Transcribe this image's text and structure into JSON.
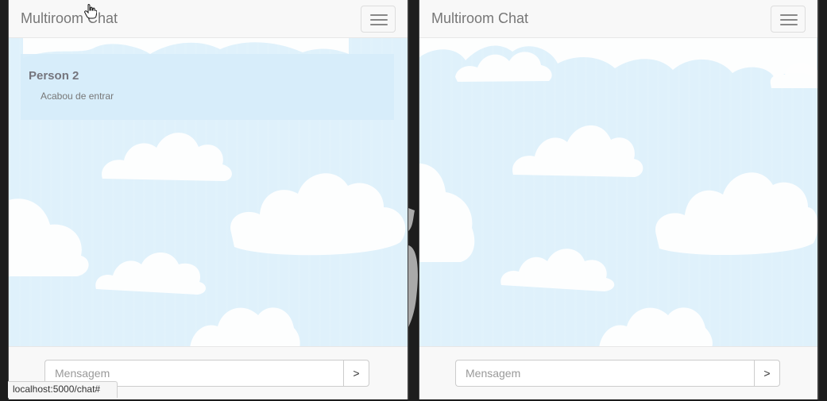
{
  "left_window": {
    "brand": "Multiroom Chat",
    "messages": [
      {
        "author": "Person 2",
        "text": "Acabou de entrar"
      }
    ],
    "input": {
      "placeholder": "Mensagem"
    },
    "send_label": ">"
  },
  "right_window": {
    "brand": "Multiroom Chat",
    "input": {
      "placeholder": "Mensagem"
    },
    "send_label": ">"
  },
  "status_bar": {
    "url": "localhost:5000/chat#"
  },
  "icons": {
    "menu": "hamburger-menu-icon",
    "cursor": "hand-pointer-cursor-icon"
  },
  "colors": {
    "sky": "#dff1fb",
    "cloud": "#ffffff",
    "navbar": "#f8f8f8",
    "message_card": "#d6ecfa"
  }
}
